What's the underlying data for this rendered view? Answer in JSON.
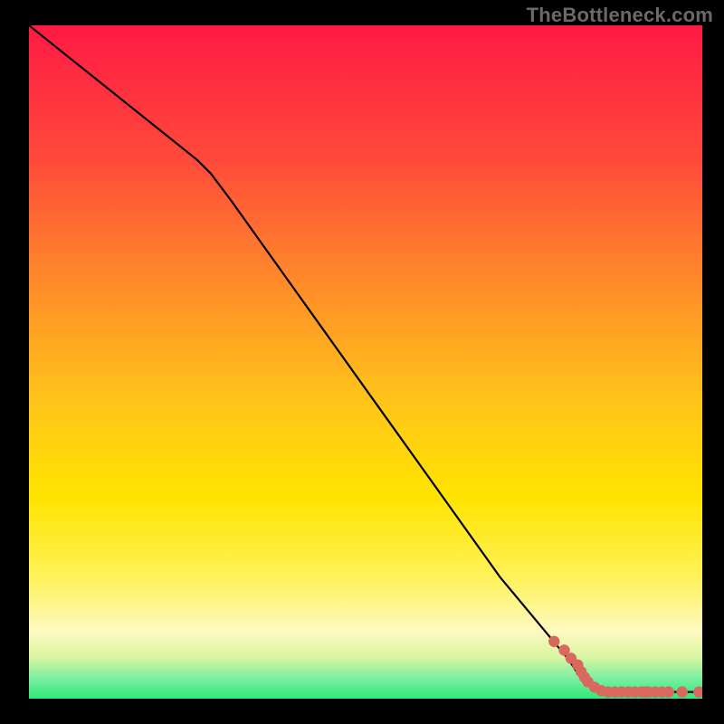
{
  "watermark": "TheBottleneck.com",
  "colors": {
    "bg": "#000000",
    "gradient_top": "#ff1a44",
    "gradient_mid_upper": "#ff8a2a",
    "gradient_mid": "#ffe400",
    "gradient_lower": "#fff7a0",
    "gradient_bottom": "#2fe97a",
    "line": "#000000",
    "dot": "#d9695f"
  },
  "chart_data": {
    "type": "line",
    "title": "",
    "xlabel": "",
    "ylabel": "",
    "xlim": [
      0,
      100
    ],
    "ylim": [
      0,
      100
    ],
    "grid": false,
    "legend": false,
    "series": [
      {
        "name": "curve",
        "style": "line",
        "x": [
          0,
          5,
          10,
          15,
          20,
          25,
          27,
          30,
          35,
          40,
          45,
          50,
          55,
          60,
          65,
          70,
          75,
          80,
          82,
          85,
          90,
          95,
          100
        ],
        "y": [
          100,
          96,
          92,
          88,
          84,
          80,
          78,
          74,
          67,
          60,
          53,
          46,
          39,
          32,
          25,
          18,
          12,
          6,
          3,
          1,
          1,
          1,
          1
        ]
      },
      {
        "name": "points",
        "style": "scatter",
        "x": [
          78,
          79.5,
          80.5,
          81.5,
          82,
          82.5,
          83,
          84,
          85,
          86,
          87,
          88,
          89,
          90,
          91,
          91.5,
          92,
          93,
          94,
          95,
          97,
          99.5
        ],
        "y": [
          8.5,
          7.2,
          6.0,
          5.0,
          4.0,
          3.2,
          2.5,
          1.7,
          1.2,
          1.0,
          1.0,
          1.0,
          1.0,
          1.0,
          1.0,
          1.0,
          1.0,
          1.0,
          1.0,
          1.0,
          1.0,
          1.0
        ]
      }
    ],
    "background_gradient_stops": [
      {
        "pos": 0.0,
        "color": "#ff1a44"
      },
      {
        "pos": 0.2,
        "color": "#ff4a3a"
      },
      {
        "pos": 0.38,
        "color": "#ff8a2a"
      },
      {
        "pos": 0.55,
        "color": "#ffc21a"
      },
      {
        "pos": 0.7,
        "color": "#ffe400"
      },
      {
        "pos": 0.82,
        "color": "#fff25a"
      },
      {
        "pos": 0.9,
        "color": "#fff9c0"
      },
      {
        "pos": 0.94,
        "color": "#d6f5a0"
      },
      {
        "pos": 0.97,
        "color": "#7aefa0"
      },
      {
        "pos": 1.0,
        "color": "#2fe97a"
      }
    ]
  }
}
